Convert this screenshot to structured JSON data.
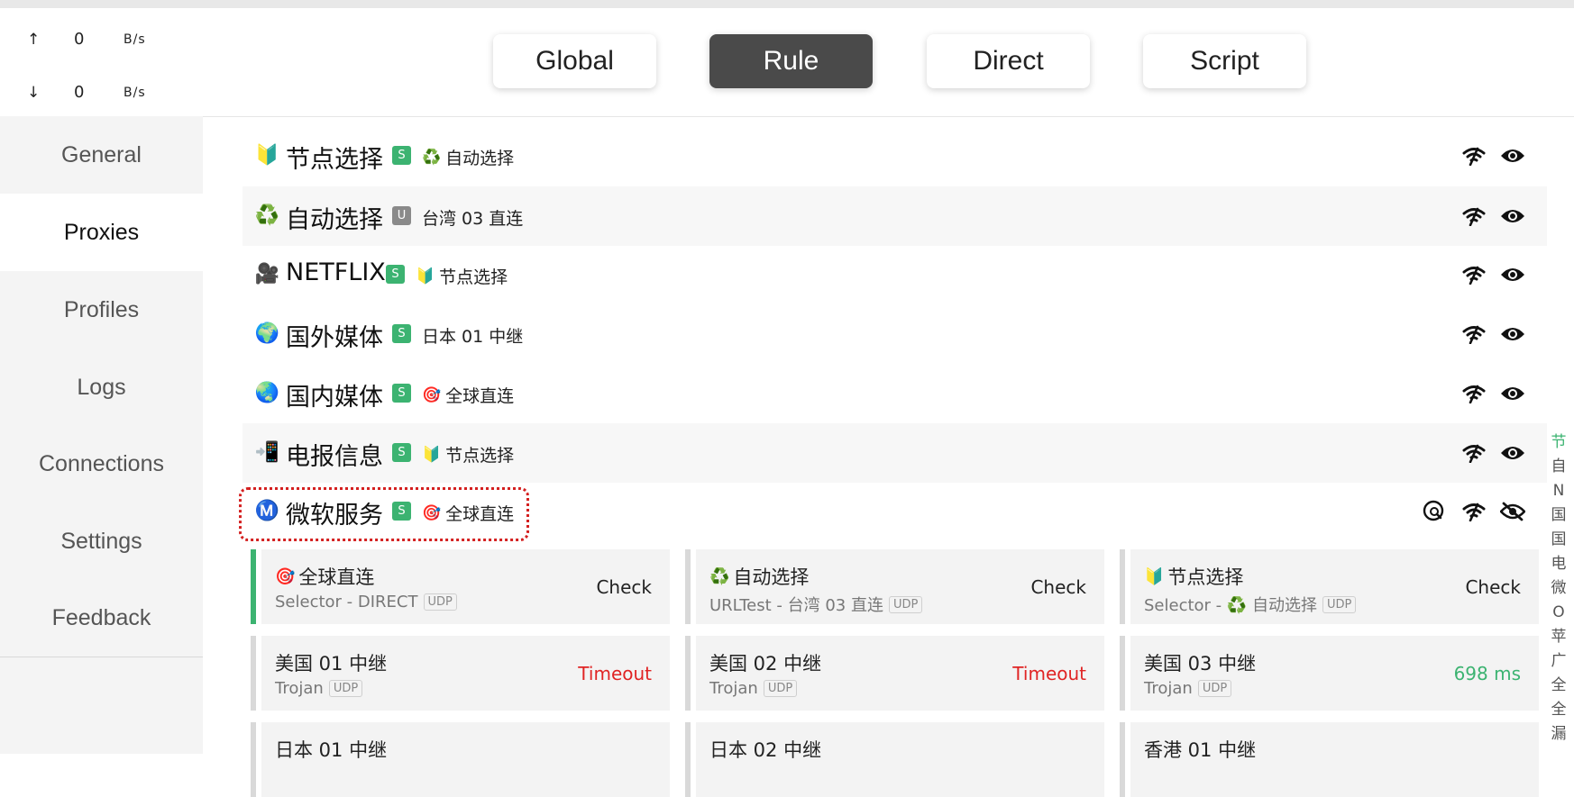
{
  "traffic": {
    "up": {
      "arrow": "↑",
      "value": "0",
      "unit": "B/s"
    },
    "down": {
      "arrow": "↓",
      "value": "0",
      "unit": "B/s"
    }
  },
  "sidebar": {
    "items": [
      {
        "label": "General",
        "active": false
      },
      {
        "label": "Proxies",
        "active": true
      },
      {
        "label": "Profiles",
        "active": false
      },
      {
        "label": "Logs",
        "active": false
      },
      {
        "label": "Connections",
        "active": false
      },
      {
        "label": "Settings",
        "active": false
      },
      {
        "label": "Feedback",
        "active": false
      }
    ]
  },
  "modes": [
    {
      "label": "Global",
      "active": false
    },
    {
      "label": "Rule",
      "active": true
    },
    {
      "label": "Direct",
      "active": false
    },
    {
      "label": "Script",
      "active": false
    }
  ],
  "groups": [
    {
      "icon": "🔰",
      "icon_name": "beginner-icon",
      "name": "节点选择",
      "badge": "S",
      "now_icon": "♻️",
      "now": "自动选择"
    },
    {
      "icon": "♻️",
      "icon_name": "recycle-icon",
      "name": "自动选择",
      "badge": "U",
      "now_icon": "",
      "now": "台湾 03 直连"
    },
    {
      "icon": "🎥",
      "icon_name": "camera-icon",
      "name": "NETFLIX",
      "badge": "S",
      "now_icon": "🔰",
      "now": "节点选择"
    },
    {
      "icon": "🌍",
      "icon_name": "globe-icon",
      "name": "国外媒体",
      "badge": "S",
      "now_icon": "",
      "now": "日本 01 中继"
    },
    {
      "icon": "🌏",
      "icon_name": "globe-asia-icon",
      "name": "国内媒体",
      "badge": "S",
      "now_icon": "🎯",
      "now": "全球直连"
    },
    {
      "icon": "📲",
      "icon_name": "phone-icon",
      "name": "电报信息",
      "badge": "S",
      "now_icon": "🔰",
      "now": "节点选择"
    },
    {
      "icon": "Ⓜ️",
      "icon_name": "m-circle-icon",
      "name": "微软服务",
      "badge": "S",
      "now_icon": "🎯",
      "now": "全球直连"
    }
  ],
  "proxies": [
    {
      "icon": "🎯",
      "name": "全球直连",
      "type": "Selector - DIRECT",
      "udp": "UDP",
      "status": "Check",
      "state": "check",
      "selected": true
    },
    {
      "icon": "♻️",
      "name": "自动选择",
      "type": "URLTest - 台湾 03 直连",
      "udp": "UDP",
      "status": "Check",
      "state": "check",
      "selected": false
    },
    {
      "icon": "🔰",
      "name": "节点选择",
      "type": "Selector - ♻️ 自动选择",
      "udp": "UDP",
      "status": "Check",
      "state": "check",
      "selected": false
    },
    {
      "icon": "",
      "name": "美国 01 中继",
      "type": "Trojan",
      "udp": "UDP",
      "status": "Timeout",
      "state": "timeout",
      "selected": false
    },
    {
      "icon": "",
      "name": "美国 02 中继",
      "type": "Trojan",
      "udp": "UDP",
      "status": "Timeout",
      "state": "timeout",
      "selected": false
    },
    {
      "icon": "",
      "name": "美国 03 中继",
      "type": "Trojan",
      "udp": "UDP",
      "status": "698 ms",
      "state": "ok",
      "selected": false
    },
    {
      "icon": "",
      "name": "日本 01 中继",
      "type": "",
      "udp": "",
      "status": "",
      "state": "timeout",
      "selected": false
    },
    {
      "icon": "",
      "name": "日本 02 中继",
      "type": "",
      "udp": "",
      "status": "",
      "state": "timeout",
      "selected": false
    },
    {
      "icon": "",
      "name": "香港 01 中继",
      "type": "",
      "udp": "",
      "status": "",
      "state": "ok",
      "selected": false
    }
  ],
  "index_letters": [
    "节",
    "自",
    "N",
    "国",
    "国",
    "电",
    "微",
    "O",
    "苹",
    "广",
    "全",
    "全",
    "漏"
  ],
  "colors": {
    "accent": "#3cb371",
    "timeout": "#e02424",
    "highlight": "#d42020",
    "active_mode": "#4a4a4a"
  }
}
